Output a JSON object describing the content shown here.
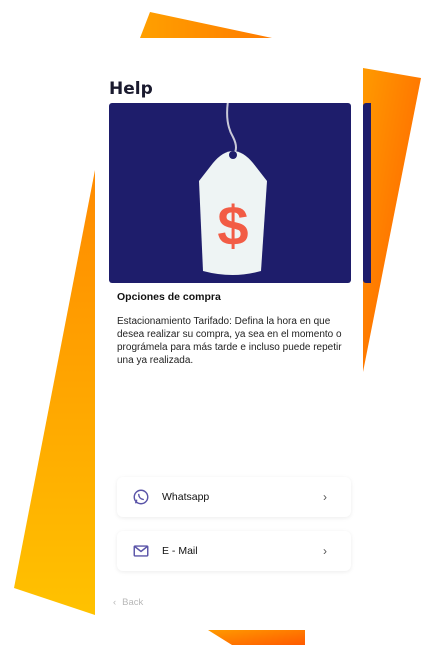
{
  "header": {
    "title": "Help"
  },
  "hero": {
    "icon": "price-tag-dollar-icon",
    "symbol": "$"
  },
  "info": {
    "title": "Opciones de compra",
    "body": "Estacionamiento Tarifado: Defina la hora en que desea realizar su compra, ya sea en el momento o prográmela para más tarde e incluso puede repetir una ya realizada."
  },
  "contacts": [
    {
      "label": "Whatsapp",
      "icon": "whatsapp-icon"
    },
    {
      "label": "E - Mail",
      "icon": "mail-icon"
    }
  ],
  "nav": {
    "back_label": "Back"
  },
  "colors": {
    "hero_bg": "#1e1d6b",
    "tag_fill": "#eef4f4",
    "dollar": "#f25c45",
    "accent_purple": "#5a54a8",
    "orange_dark": "#ff6a00",
    "orange_light": "#ffb300"
  }
}
